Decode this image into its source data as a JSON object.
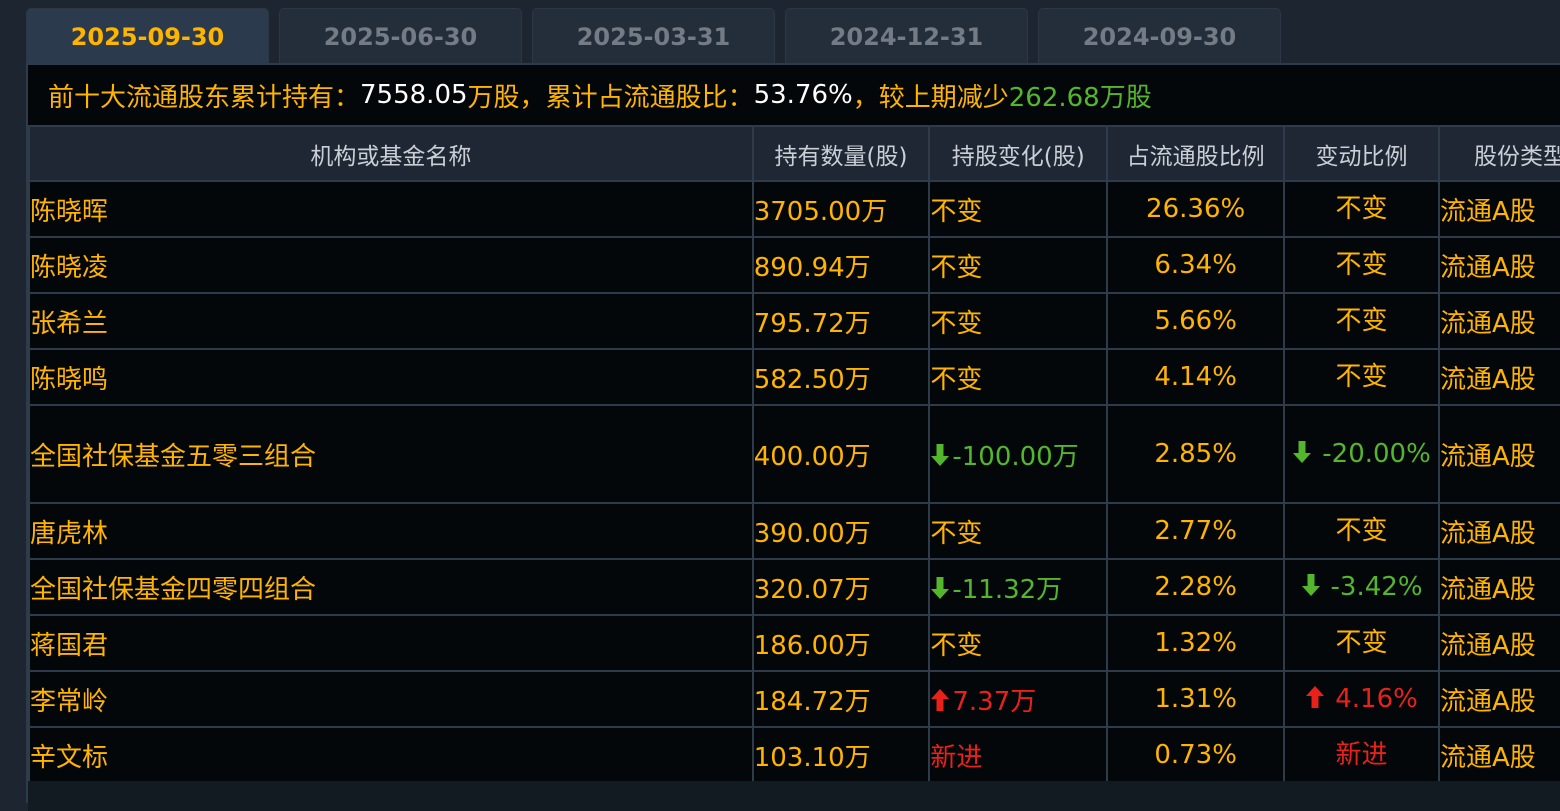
{
  "tabs": [
    {
      "label": "2025-09-30",
      "active": true
    },
    {
      "label": "2025-06-30",
      "active": false
    },
    {
      "label": "2025-03-31",
      "active": false
    },
    {
      "label": "2024-12-31",
      "active": false
    },
    {
      "label": "2024-09-30",
      "active": false
    }
  ],
  "summary": {
    "label1": "前十大流通股东累计持有：",
    "total": "7558.05",
    "unit1": "万股，",
    "label2": "累计占流通股比：",
    "ratio": "53.76%",
    "label3": " ，较上期减少",
    "change": "262.68万股"
  },
  "table": {
    "headers": [
      "机构或基金名称",
      "持有数量(股)",
      "持股变化(股)",
      "占流通股比例",
      "变动比例",
      "股份类型"
    ],
    "rows": [
      {
        "name": "陈晓晖",
        "qty": "3705.00万",
        "chg": "不变",
        "chg_dir": "none",
        "pct": "26.36%",
        "ratio": "不变",
        "ratio_dir": "none",
        "type": "流通A股"
      },
      {
        "name": "陈晓凌",
        "qty": "890.94万",
        "chg": "不变",
        "chg_dir": "none",
        "pct": "6.34%",
        "ratio": "不变",
        "ratio_dir": "none",
        "type": "流通A股"
      },
      {
        "name": "张希兰",
        "qty": "795.72万",
        "chg": "不变",
        "chg_dir": "none",
        "pct": "5.66%",
        "ratio": "不变",
        "ratio_dir": "none",
        "type": "流通A股"
      },
      {
        "name": "陈晓鸣",
        "qty": "582.50万",
        "chg": "不变",
        "chg_dir": "none",
        "pct": "4.14%",
        "ratio": "不变",
        "ratio_dir": "none",
        "type": "流通A股"
      },
      {
        "name": "全国社保基金五零三组合",
        "qty": "400.00万",
        "chg": "-100.00万",
        "chg_dir": "down",
        "pct": "2.85%",
        "ratio": "-20.00%",
        "ratio_dir": "down",
        "type": "流通A股"
      },
      {
        "name": "唐虎林",
        "qty": "390.00万",
        "chg": "不变",
        "chg_dir": "none",
        "pct": "2.77%",
        "ratio": "不变",
        "ratio_dir": "none",
        "type": "流通A股"
      },
      {
        "name": "全国社保基金四零四组合",
        "qty": "320.07万",
        "chg": "-11.32万",
        "chg_dir": "down",
        "pct": "2.28%",
        "ratio": "-3.42%",
        "ratio_dir": "down",
        "type": "流通A股"
      },
      {
        "name": "蒋国君",
        "qty": "186.00万",
        "chg": "不变",
        "chg_dir": "none",
        "pct": "1.32%",
        "ratio": "不变",
        "ratio_dir": "none",
        "type": "流通A股"
      },
      {
        "name": "李常岭",
        "qty": "184.72万",
        "chg": "7.37万",
        "chg_dir": "up",
        "pct": "1.31%",
        "ratio": "4.16%",
        "ratio_dir": "up",
        "type": "流通A股"
      },
      {
        "name": "辛文标",
        "qty": "103.10万",
        "chg": "新进",
        "chg_dir": "new",
        "pct": "0.73%",
        "ratio": "新进",
        "ratio_dir": "new",
        "type": "流通A股"
      }
    ]
  },
  "colors": {
    "accent": "#ffb400",
    "increase": "#e8211a",
    "decrease": "#54b62c",
    "background": "#04070a"
  }
}
